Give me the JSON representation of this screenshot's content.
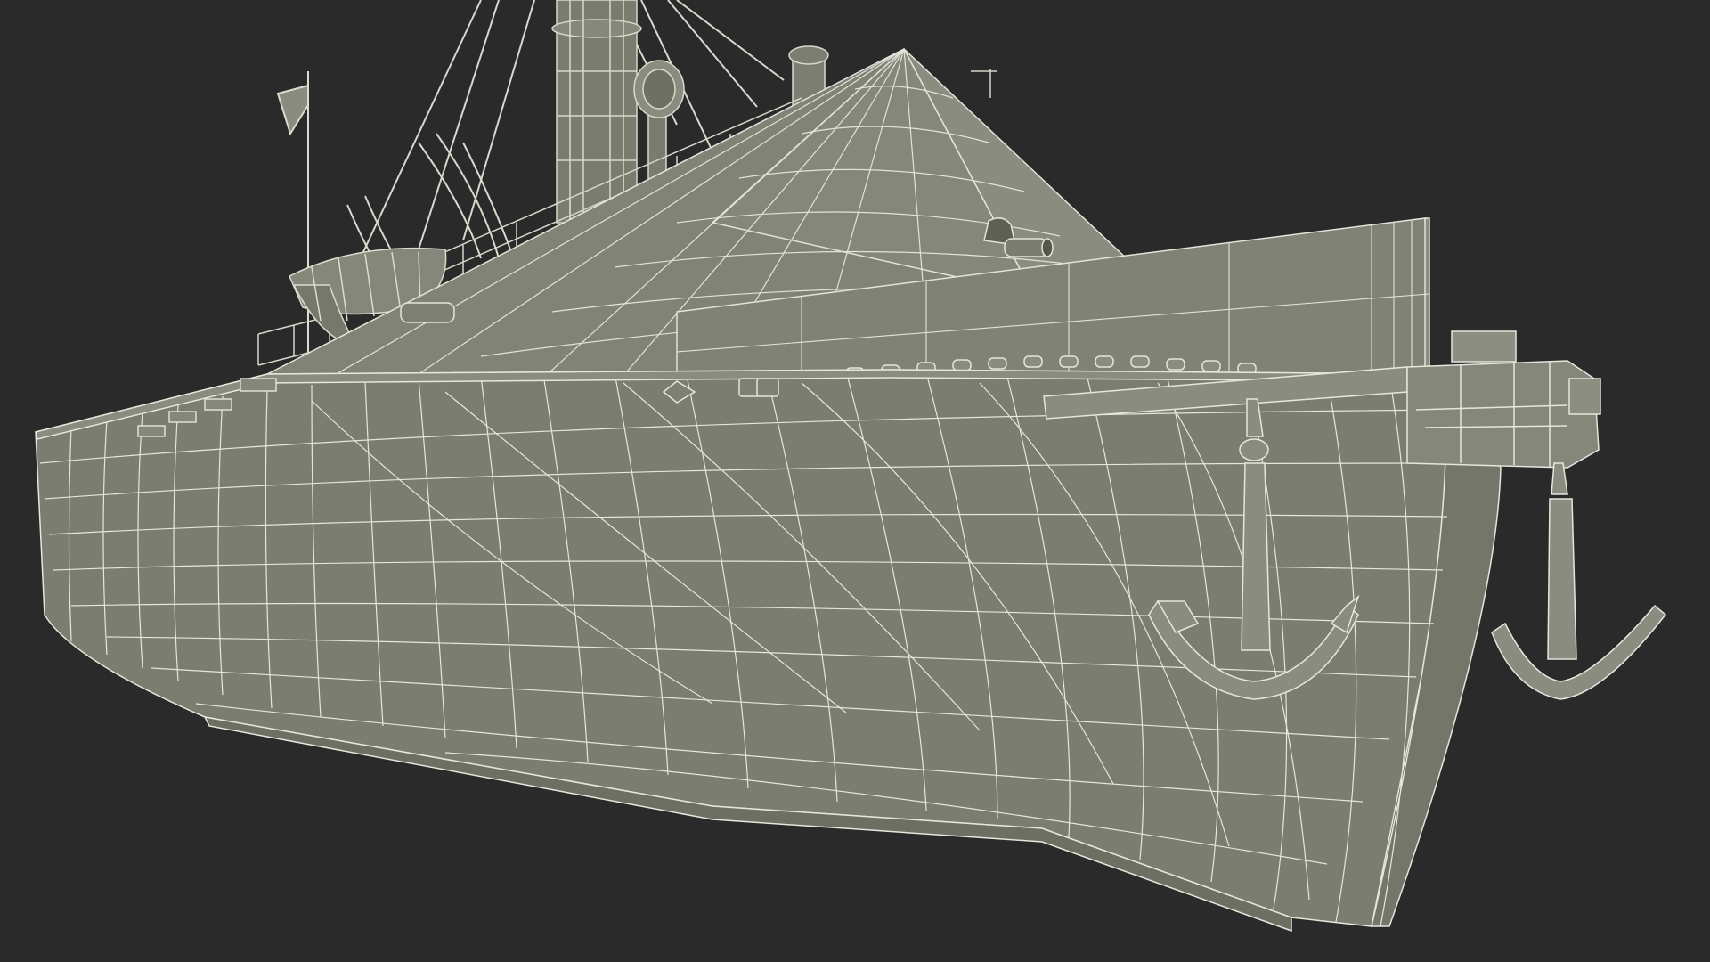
{
  "scene": {
    "subject": "",
    "colors": {
      "background": "#2a2a2a",
      "hull_fill": "#7b7d70",
      "hull_shadow": "#6d6f63",
      "deck_fill": "#818377",
      "wire": "#e6e6dc",
      "wire_dim": "#cfcfc4"
    }
  }
}
